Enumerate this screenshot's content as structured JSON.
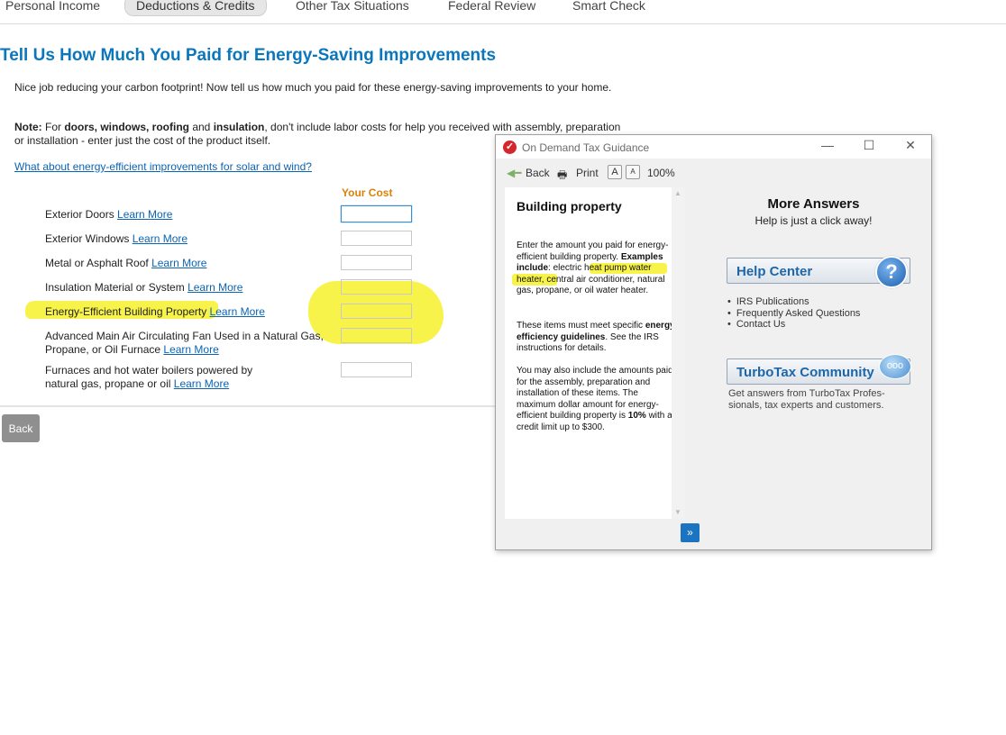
{
  "nav": {
    "tabs": [
      {
        "label": "Personal Income"
      },
      {
        "label": "Deductions & Credits"
      },
      {
        "label": "Other Tax Situations"
      },
      {
        "label": "Federal Review"
      },
      {
        "label": "Smart Check"
      }
    ],
    "active_tab": "Deductions & Credits"
  },
  "page": {
    "title": "Tell Us How Much You Paid for Energy-Saving Improvements",
    "intro": "Nice job reducing your carbon footprint! Now tell us how much you paid for these energy-saving improvements to your home.",
    "note_label": "Note:",
    "note_t1": " For ",
    "note_b1": "doors, windows, roofing",
    "note_t2": " and ",
    "note_b2": "insulation",
    "note_t3": ", don't include labor costs for help you received with assembly, preparation or installation - enter just the cost of the product itself.",
    "solar_link": "What about energy-efficient improvements for solar and wind?",
    "cost_header": "Your Cost",
    "learn_more": "Learn More",
    "rows": [
      {
        "label": "Exterior Doors",
        "value": ""
      },
      {
        "label": "Exterior Windows",
        "value": ""
      },
      {
        "label": "Metal or Asphalt Roof",
        "value": ""
      },
      {
        "label": "Insulation Material or System",
        "value": ""
      },
      {
        "label": "Energy-Efficient Building Property",
        "value": ""
      },
      {
        "label_line1": "Advanced Main Air Circulating Fan Used in a Natural Gas,",
        "label_line2": "Propane, or Oil Furnace",
        "value": ""
      },
      {
        "label_line1": "Furnaces and hot water boilers powered by",
        "label_line2": "natural gas, propane or oil",
        "value": ""
      }
    ],
    "back_button": "Back"
  },
  "popup": {
    "window_title": "On Demand Tax Guidance",
    "back": "Back",
    "print": "Print",
    "font_larger": "A",
    "font_smaller": "A",
    "zoom": "100%",
    "heading": "Building property",
    "p1_t1": "Enter the amount you paid for energy-efficient building property. ",
    "p1_b1": "Examples include",
    "p1_t2": ": electric heat pump water heater, central air conditioner, natural gas, propane, or oil water heater.",
    "p2_t1": "These items must meet specific ",
    "p2_b1": "energy efficiency guidelines",
    "p2_t2": ". See the IRS instructions for details.",
    "p3_t1": "You may also include the amounts paid for the assembly, preparation and installation of these items. The maximum dollar amount for energy-efficient building property is ",
    "p3_b1": "10%",
    "p3_t2": " with a credit limit up to $300.",
    "next": "»",
    "more_answers": "More Answers",
    "more_answers_sub": "Help is just a click away!",
    "help_center": "Help Center",
    "help_icon": "?",
    "help_items": [
      "IRS Publications",
      "Frequently Asked Questions",
      "Contact Us"
    ],
    "community": "TurboTax Community",
    "community_icon": "ooo",
    "community_desc": "Get answers from TurboTax Profes-sionals, tax experts and customers."
  },
  "colors": {
    "title_blue": "#0a77bd",
    "link_blue": "#0a64b5",
    "cost_orange": "#d9820a",
    "highlight_yellow": "#f7f12a"
  }
}
